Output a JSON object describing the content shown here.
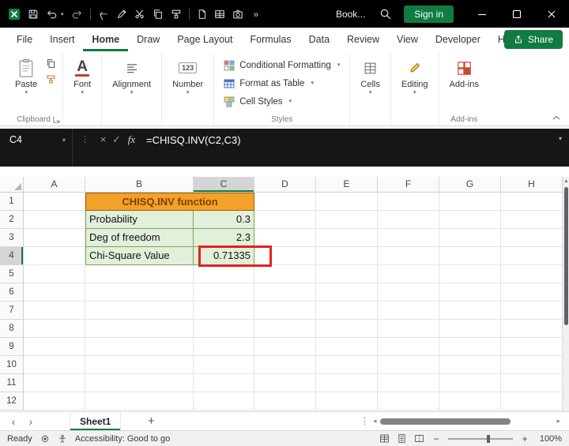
{
  "titlebar": {
    "title": "Book...",
    "signin": "Sign in"
  },
  "menubar": {
    "items": [
      "File",
      "Insert",
      "Home",
      "Draw",
      "Page Layout",
      "Formulas",
      "Data",
      "Review",
      "View",
      "Developer",
      "Help"
    ],
    "active_item": "Home",
    "share": "Share"
  },
  "ribbon": {
    "paste": "Paste",
    "clipboard_group": "Clipboard",
    "font": "Font",
    "alignment": "Alignment",
    "number": "Number",
    "conditional_formatting": "Conditional Formatting",
    "format_as_table": "Format as Table",
    "cell_styles": "Cell Styles",
    "styles_group": "Styles",
    "cells": "Cells",
    "editing": "Editing",
    "addins": "Add-ins",
    "addins_group": "Add-ins"
  },
  "formula_bar": {
    "name_box": "C4",
    "fx": "fx",
    "formula": "=CHISQ.INV(C2,C3)"
  },
  "grid": {
    "columns": [
      "A",
      "B",
      "C",
      "D",
      "E",
      "F",
      "G",
      "H"
    ],
    "row_count": 12,
    "selected_column": "C",
    "selected_row": 4,
    "cells": {
      "B1": {
        "text": "CHISQ.INV function",
        "merge": 2,
        "class": "title-cell"
      },
      "B2": {
        "text": "Probability",
        "class": "green-cell first"
      },
      "C2": {
        "text": "0.3",
        "class": "green-cell num"
      },
      "B3": {
        "text": "Deg of freedom",
        "class": "green-cell first"
      },
      "C3": {
        "text": "2.3",
        "class": "green-cell num"
      },
      "B4": {
        "text": "Chi-Square Value",
        "class": "green-cell first"
      },
      "C4": {
        "text": "0.71335",
        "class": "green-cell num active"
      }
    }
  },
  "sheet_tabs": {
    "active_tab": "Sheet1"
  },
  "status_bar": {
    "mode": "Ready",
    "accessibility": "Accessibility: Good to go",
    "zoom": "100%"
  },
  "icons": {
    "chevron_down": "▾",
    "chevron_up": "▴",
    "overflow": "»",
    "close_x": "×",
    "check": "✓",
    "dots_vertical": "⋮",
    "plus": "+",
    "minus": "−",
    "nav_left": "‹",
    "nav_right": "›",
    "scroll_left": "◂",
    "scroll_right": "▸",
    "scroll_up": "▴",
    "font_a": "A",
    "number_badge": "123"
  },
  "colors": {
    "accent_green": "#107c41",
    "titlebar_bg": "#000000",
    "formula_bar_bg": "#161616",
    "orange_cell_bg": "#f2a229",
    "orange_cell_text": "#833c00",
    "green_cell_bg": "#e2efda",
    "green_cell_border": "#79a65e",
    "highlight_red": "#e3211b",
    "selected_header_bg": "#d5d5d5"
  }
}
